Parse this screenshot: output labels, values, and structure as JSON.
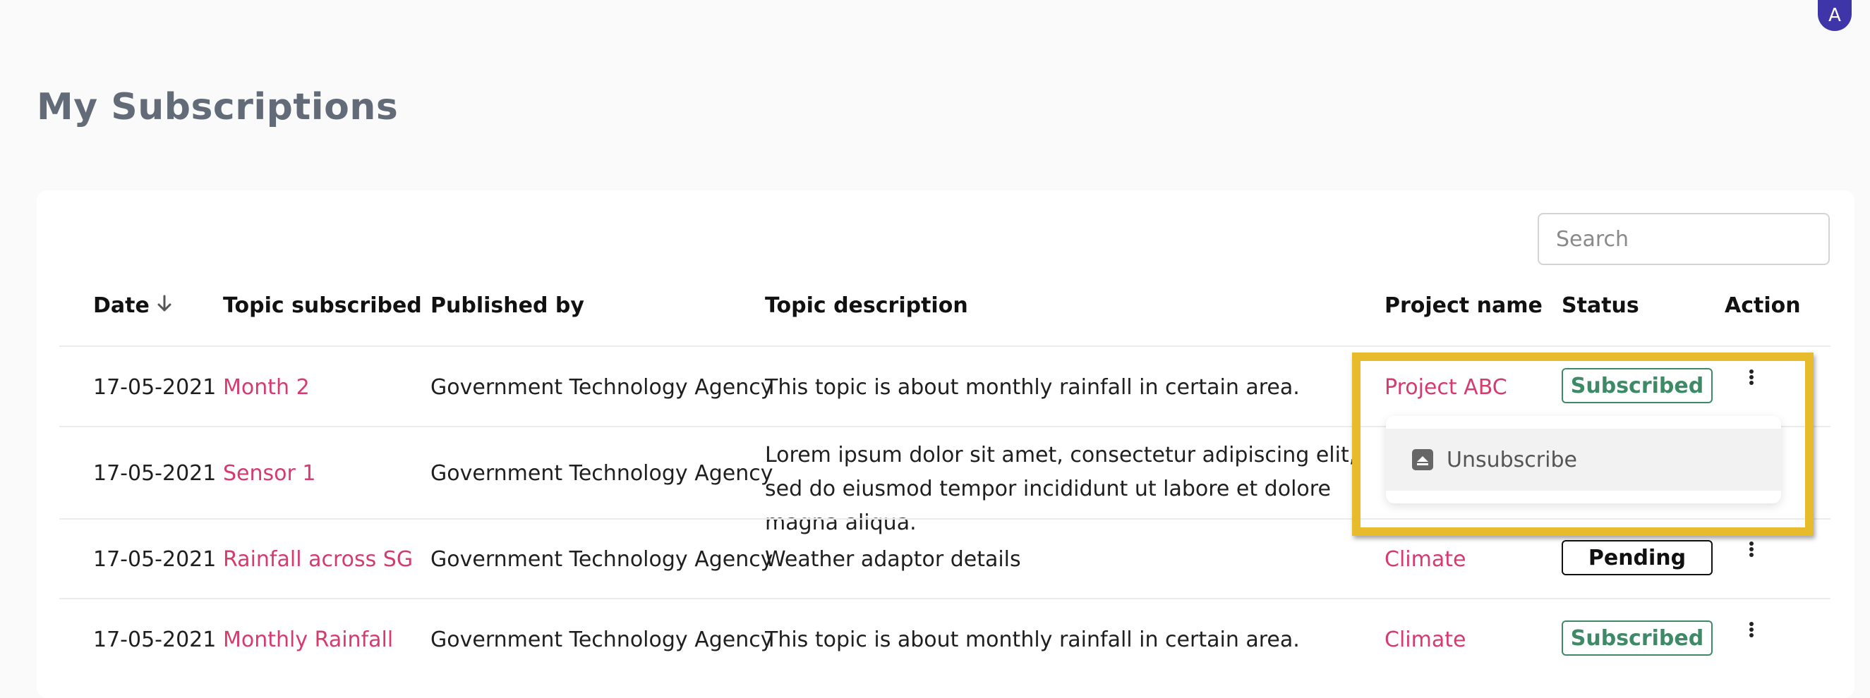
{
  "user": {
    "avatar_initial": "A"
  },
  "page": {
    "title": "My Subscriptions"
  },
  "search": {
    "placeholder": "Search",
    "value": ""
  },
  "table": {
    "headers": {
      "date": "Date",
      "topic": "Topic subscribed",
      "publisher": "Published by",
      "description": "Topic description",
      "project": "Project name",
      "status": "Status",
      "action": "Action"
    },
    "rows": [
      {
        "date": "17-05-2021",
        "topic": "Month 2",
        "publisher": "Government Technology Agency",
        "description": "This topic is about monthly rainfall in certain area.",
        "project": "Project ABC",
        "status": "Subscribed"
      },
      {
        "date": "17-05-2021",
        "topic": "Sensor 1",
        "publisher": "Government Technology Agency",
        "description": "Lorem ipsum dolor sit amet, consectetur adipiscing elit, sed do eiusmod tempor incididunt ut labore et dolore magna aliqua.",
        "project": "",
        "status": ""
      },
      {
        "date": "17-05-2021",
        "topic": "Rainfall across SG",
        "publisher": "Government Technology Agency",
        "description": "Weather adaptor details",
        "project": "Climate",
        "status": "Pending"
      },
      {
        "date": "17-05-2021",
        "topic": "Monthly Rainfall",
        "publisher": "Government Technology Agency",
        "description": "This topic is about monthly rainfall in certain area.",
        "project": "Climate",
        "status": "Subscribed"
      }
    ]
  },
  "action_menu": {
    "unsubscribe_label": "Unsubscribe"
  },
  "colors": {
    "link": "#d63b6e",
    "subscribed": "#3e8a67",
    "pending": "#111111",
    "highlight": "#e8bb2c",
    "avatar": "#3d35a8"
  },
  "icons": {
    "sort": "arrow-down-icon",
    "action": "kebab-menu-icon",
    "unsubscribe": "archive-icon"
  }
}
